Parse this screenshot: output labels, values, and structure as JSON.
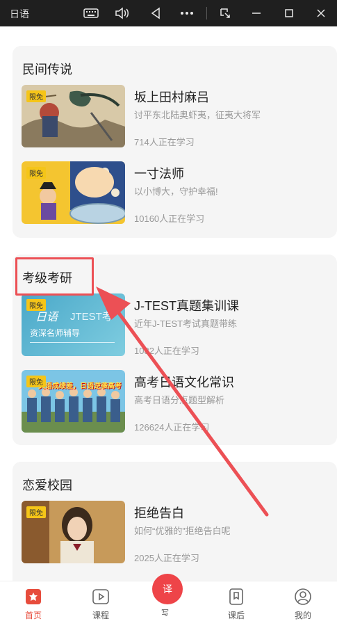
{
  "window": {
    "title": "日语"
  },
  "sections": [
    {
      "title": "民间传说",
      "courses": [
        {
          "badge": "限免",
          "name": "坂上田村麻吕",
          "desc": "讨平东北陆奥虾夷，征夷大将军",
          "count": "714人正在学习"
        },
        {
          "badge": "限免",
          "name": "一寸法师",
          "desc": "以小博大，守护幸福!",
          "count": "10160人正在学习"
        }
      ]
    },
    {
      "title": "考级考研",
      "courses": [
        {
          "badge": "限免",
          "name": "J-TEST真题集训课",
          "desc": "近年J-TEST考试真题带练",
          "count": "1082人正在学习",
          "thumb_text1": "日语",
          "thumb_text2": "JTEST考",
          "thumb_text3": "资深名师辅导"
        },
        {
          "badge": "限免",
          "name": "高考日语文化常识",
          "desc": "高考日语分点题型解析",
          "count": "126624人正在学习",
          "thumb_text1": "英语成绩差，日语逆袭高考"
        }
      ]
    },
    {
      "title": "恋爱校园",
      "courses": [
        {
          "badge": "限免",
          "name": "拒绝告白",
          "desc": "如何“优雅的”拒绝告白呢",
          "count": "2025人正在学习"
        }
      ]
    }
  ],
  "nav": [
    {
      "label": "首页",
      "icon": "home-icon"
    },
    {
      "label": "课程",
      "icon": "play-icon"
    },
    {
      "label": "课后",
      "icon": "bookmark-icon"
    },
    {
      "label": "我的",
      "icon": "profile-icon"
    }
  ],
  "fab": {
    "label": "译",
    "caption": "写"
  },
  "colors": {
    "accent": "#e74c3c",
    "badge": "#f5c518",
    "annotation": "#ec5055"
  }
}
